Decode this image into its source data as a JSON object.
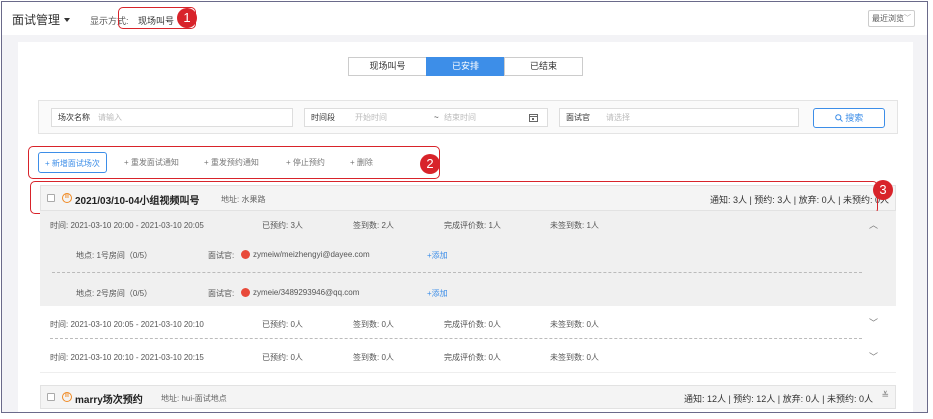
{
  "header": {
    "title": "面试管理",
    "display_label": "显示方式:",
    "display_value": "现场叫号",
    "recent_select": "最近浏览"
  },
  "markers": [
    "1",
    "2",
    "3"
  ],
  "tabs": [
    {
      "label": "现场叫号",
      "active": false
    },
    {
      "label": "已安排",
      "active": true
    },
    {
      "label": "已结束",
      "active": false
    }
  ],
  "search": {
    "session_label": "场次名称",
    "session_placeholder": "请输入",
    "period_label": "时间段",
    "start_placeholder": "开始时间",
    "tilde": "~",
    "end_placeholder": "结束时间",
    "interviewer_label": "面试官",
    "interviewer_placeholder": "请选择",
    "search_button": "搜索"
  },
  "toolbar": {
    "add": "+ 新增面试场次",
    "resend_interview": "+ 重发面试通知",
    "resend_booking": "+ 重发预约通知",
    "stop_booking": "+ 停止预约",
    "delete": "+ 删除"
  },
  "sessions": [
    {
      "name": "2021/03/10-04小组视频叫号",
      "address": "地址: 水果路",
      "stats": "通知: 3人 | 预约: 3人 | 放弃: 0人 | 未预约: 0人",
      "slots": [
        {
          "time": "时间: 2021-03-10 20:00 - 2021-03-10 20:05",
          "booked": "已预约: 3人",
          "signed": "签到数: 2人",
          "evaluated": "完成评价数: 1人",
          "unsigned": "未签到数: 1人",
          "rooms": [
            {
              "place": "地点: 1号房间（0/5）",
              "interviewer_label": "面试官:",
              "interviewer": "zymeiw/meizhengyi@dayee.com",
              "add": "+添加"
            },
            {
              "place": "地点: 2号房间（0/5）",
              "interviewer_label": "面试官:",
              "interviewer": "zymeie/3489293946@qq.com",
              "add": "+添加"
            }
          ]
        },
        {
          "time": "时间: 2021-03-10 20:05 - 2021-03-10 20:10",
          "booked": "已预约: 0人",
          "signed": "签到数: 0人",
          "evaluated": "完成评价数: 0人",
          "unsigned": "未签到数: 0人"
        },
        {
          "time": "时间: 2021-03-10 20:10 - 2021-03-10 20:15",
          "booked": "已预约: 0人",
          "signed": "签到数: 0人",
          "evaluated": "完成评价数: 0人",
          "unsigned": "未签到数: 0人"
        }
      ]
    },
    {
      "name": "marry场次预约",
      "address": "地址: hui-面试地点",
      "stats": "通知: 12人 | 预约: 12人 | 放弃: 0人 | 未预约: 0人"
    }
  ],
  "icons": {
    "caret": "caret-down-icon",
    "search": "search-icon",
    "calendar": "calendar-icon",
    "session": "session-badge-icon",
    "person": "person-icon",
    "chevron_up": "chevron-up-icon",
    "chevron_down": "chevron-down-icon",
    "double_chevron": "double-chevron-down-icon"
  },
  "colors": {
    "accent": "#3d8ee8",
    "annotation_red": "#d8232a",
    "session_icon": "#f08a24"
  }
}
